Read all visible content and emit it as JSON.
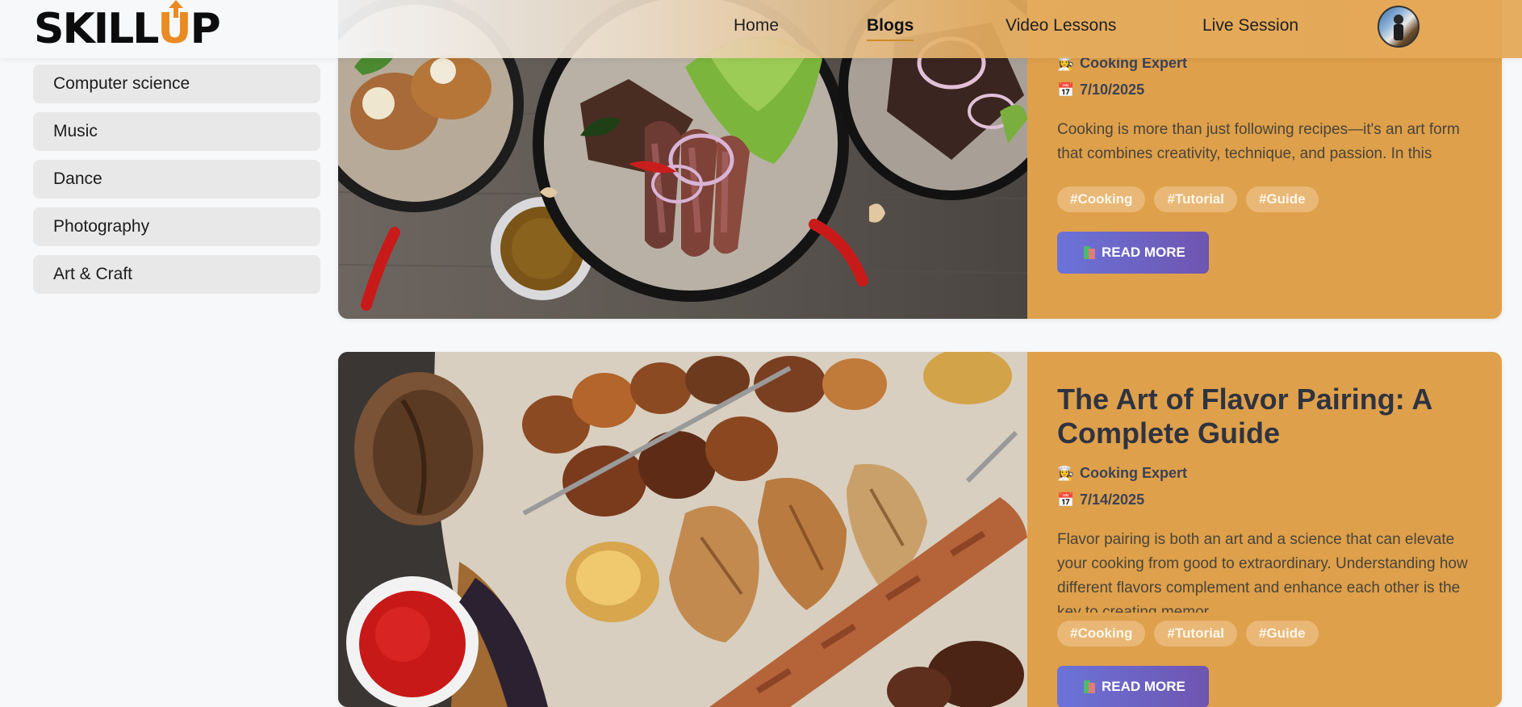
{
  "brand": {
    "logo_text_left": "SKILL",
    "logo_text_u": "U",
    "logo_text_right": "P"
  },
  "nav": {
    "items": [
      "Home",
      "Blogs",
      "Video Lessons",
      "Live Session"
    ],
    "active": "Blogs"
  },
  "sidebar": {
    "categories": [
      "Computer science",
      "Music",
      "Dance",
      "Photography",
      "Art & Craft"
    ]
  },
  "posts": [
    {
      "title": "",
      "author": "Cooking Expert",
      "date": "7/10/2025",
      "excerpt": "Cooking is more than just following recipes—it's an art form that combines creativity, technique, and passion. In this",
      "tags": [
        "#Cooking",
        "#Tutorial",
        "#Guide"
      ],
      "read_more": "READ MORE"
    },
    {
      "title": "The Art of Flavor Pairing: A Complete Guide",
      "author": "Cooking Expert",
      "date": "7/14/2025",
      "excerpt": "Flavor pairing is both an art and a science that can elevate your cooking from good to extraordinary. Understanding how different flavors complement and enhance each other is the key to creating memor",
      "tags": [
        "#Cooking",
        "#Tutorial",
        "#Guide"
      ],
      "read_more": "READ MORE"
    }
  ],
  "icons": {
    "author": "chef-icon",
    "date": "calendar-icon",
    "read_more": "books-icon"
  },
  "colors": {
    "card_bg": "#dea04b",
    "button_start": "#6b73d8",
    "button_end": "#6e55b0",
    "accent": "#e98b22"
  }
}
